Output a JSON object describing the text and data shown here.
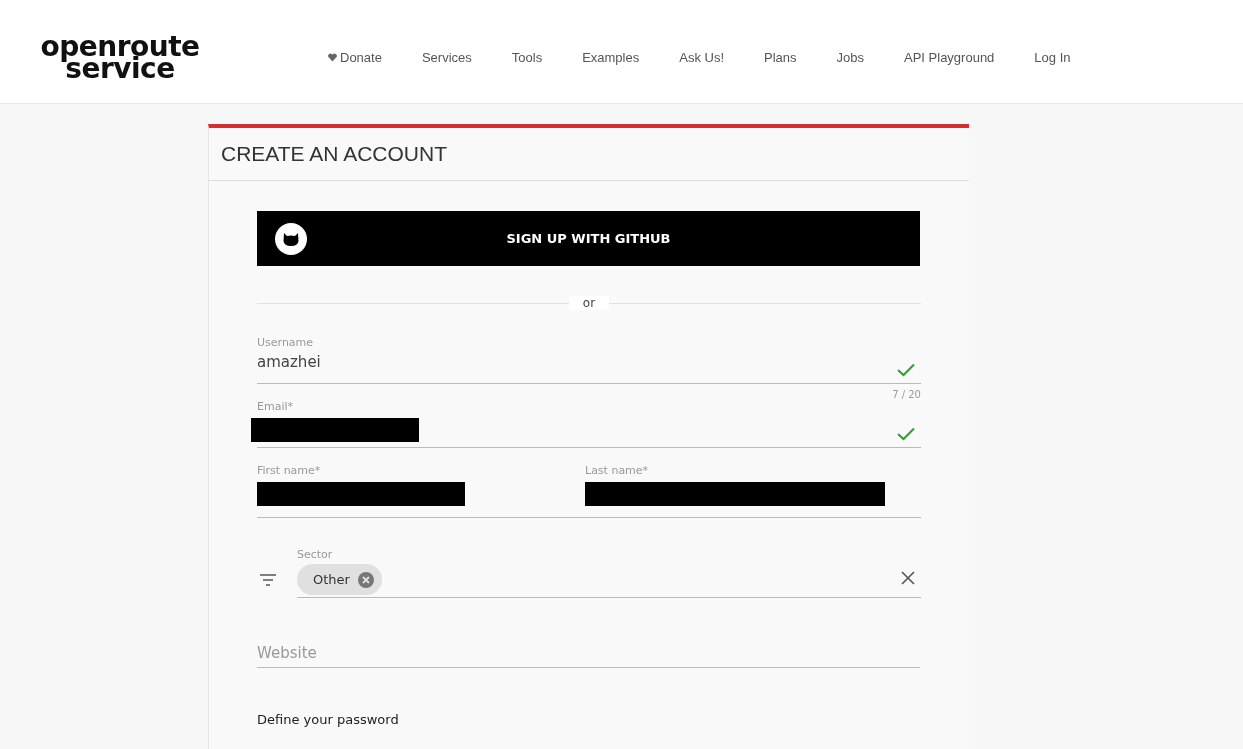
{
  "logo": {
    "line_1": "openroute",
    "line_2": "service"
  },
  "nav": [
    {
      "label": "Donate",
      "kind": "donate"
    },
    {
      "label": "Services",
      "kind": "link"
    },
    {
      "label": "Tools",
      "kind": "link"
    },
    {
      "label": "Examples",
      "kind": "link"
    },
    {
      "label": "Ask Us!",
      "kind": "link"
    },
    {
      "label": "Plans",
      "kind": "link"
    },
    {
      "label": "Jobs",
      "kind": "link"
    },
    {
      "label": "API Playground",
      "kind": "link"
    },
    {
      "label": "Log In",
      "kind": "link"
    }
  ],
  "card": {
    "title": "CREATE AN ACCOUNT",
    "github_button": "SIGN UP WITH GITHUB",
    "divider": "or",
    "username": {
      "label": "Username",
      "value": "amazhei",
      "valid": true,
      "counter": "7 / 20"
    },
    "email": {
      "label": "Email*",
      "redacted": true,
      "valid": true
    },
    "first_name": {
      "label": "First name*",
      "redacted": true
    },
    "last_name": {
      "label": "Last name*",
      "redacted": true
    },
    "sector": {
      "label": "Sector",
      "chips": [
        "Other"
      ]
    },
    "website": {
      "placeholder": "Website"
    },
    "password_heading": "Define your password"
  }
}
